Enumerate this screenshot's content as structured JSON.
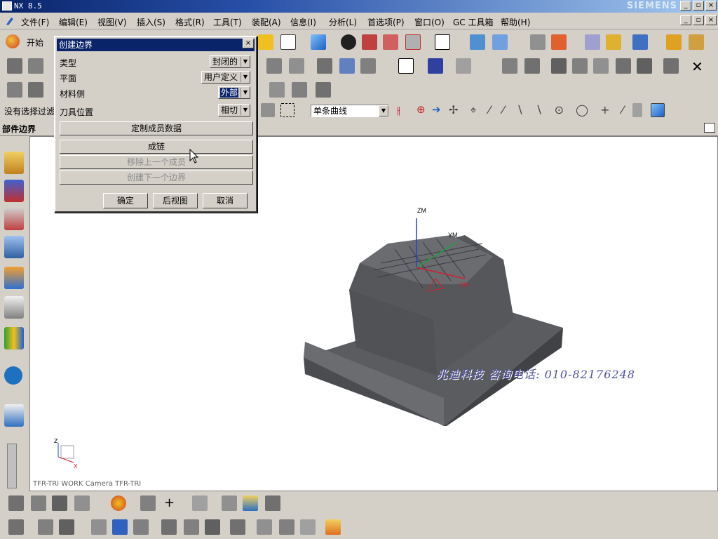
{
  "app": {
    "title": "NX 8.5",
    "brand": "SIEMENS",
    "window_buttons": [
      "_",
      "▯",
      "×"
    ]
  },
  "menu": {
    "start": "开始",
    "items": [
      "文件(F)",
      "编辑(E)",
      "视图(V)",
      "插入(S)",
      "格式(R)",
      "工具(T)",
      "装配(A)",
      "信息(I)",
      "分析(L)",
      "首选项(P)",
      "窗口(O)",
      "GC 工具箱",
      "帮助(H)"
    ]
  },
  "toolbar": {
    "selection_filter": "没有选择过滤",
    "curve_rule": "单条曲线",
    "part_nav_label": "部件边界"
  },
  "dialog": {
    "title": "创建边界",
    "close": "×",
    "rows": [
      {
        "label": "类型",
        "value": "封闭的"
      },
      {
        "label": "平面",
        "value": "用户定义"
      },
      {
        "label": "材料侧",
        "value": "外部"
      },
      {
        "label": "刀具位置",
        "value": "相切"
      }
    ],
    "wide_buttons": [
      {
        "label": "定制成员数据",
        "enabled": true
      },
      {
        "label": "成链",
        "enabled": true
      },
      {
        "label": "移除上一个成员",
        "enabled": false
      },
      {
        "label": "创建下一个边界",
        "enabled": false
      }
    ],
    "ok": "确定",
    "back": "后视图",
    "cancel": "取消"
  },
  "viewport": {
    "axis_z": "ZM",
    "axis_y": "YM",
    "axis_x": "XM",
    "triad_z": "Z",
    "triad_x": "X",
    "camera_label": "TFR-TRI WORK Camera TFR-TRI",
    "watermark": "兆迪科技 咨询电话: 010-82176248"
  },
  "colors": {
    "title_bar": "#0a246a",
    "model": "#5a5c60",
    "base": "#6a6c70",
    "face_bg": "#d4d0c8"
  }
}
